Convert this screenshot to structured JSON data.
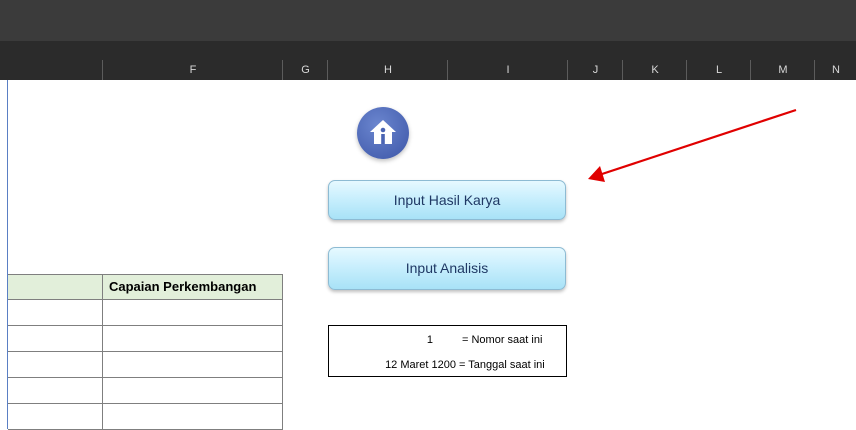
{
  "column_headers": [
    "F",
    "G",
    "H",
    "I",
    "J",
    "K",
    "L",
    "M",
    "N"
  ],
  "table": {
    "header": "Capaian Perkembangan",
    "empty_rows": 5
  },
  "home_button": {
    "icon": "home-icon"
  },
  "buttons": {
    "input_hasil_karya": "Input Hasil Karya",
    "input_analisis": "Input Analisis"
  },
  "info": {
    "nomor_value": "1",
    "nomor_label": "= Nomor saat ini",
    "tanggal_value": "12 Maret 1200",
    "tanggal_label": "= Tanggal saat ini"
  },
  "colors": {
    "header_fill": "#e2efda",
    "button_fill": "#c9effd",
    "button_text": "#1f3864",
    "home_circle": "#4a64b3",
    "annotation_arrow": "#e00000"
  }
}
